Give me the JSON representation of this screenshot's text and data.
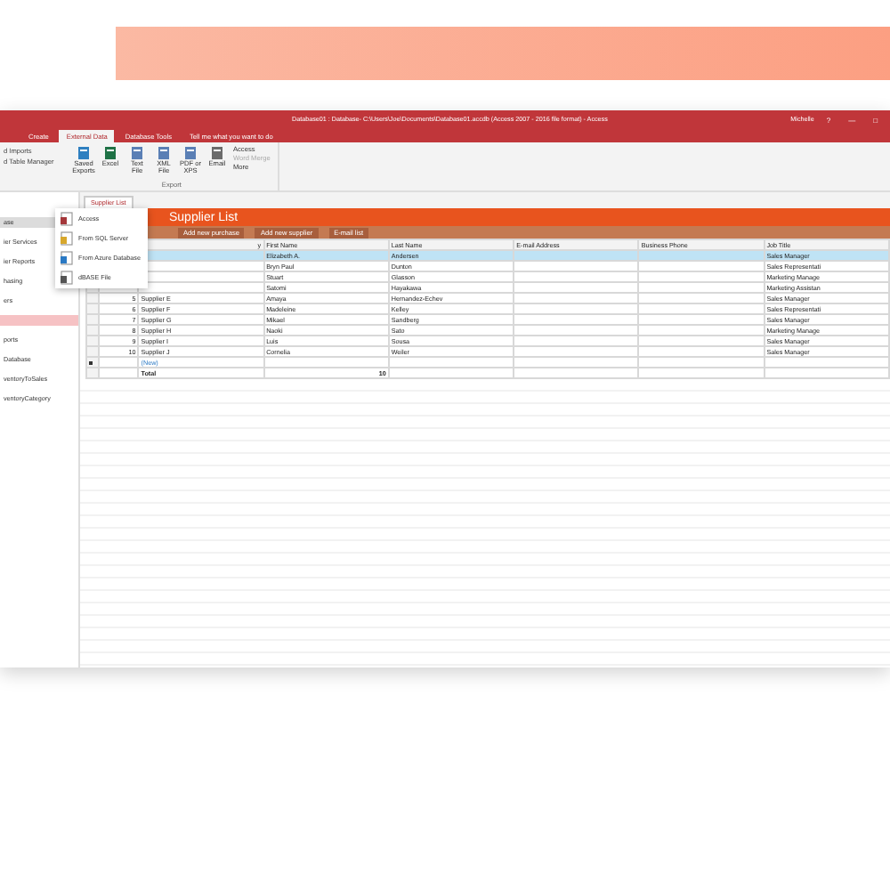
{
  "window": {
    "title": "Database01 : Database- C:\\Users\\Joe\\Documents\\Database01.accdb (Access 2007 - 2016 file format) - Access",
    "user": "Michelle",
    "controls": [
      "?",
      "—",
      "□"
    ]
  },
  "ribbon_tabs": [
    {
      "label": "Create",
      "selected": false
    },
    {
      "label": "External Data",
      "selected": true
    },
    {
      "label": "Database Tools",
      "selected": false
    }
  ],
  "tell_me": "Tell me what you want to do",
  "ribbon": {
    "left": [
      "d Imports",
      "d Table Manager"
    ],
    "buttons": [
      {
        "label": "Saved Exports",
        "kind": "saved"
      },
      {
        "label": "Excel",
        "kind": "excel"
      },
      {
        "label": "Text File",
        "kind": "text"
      },
      {
        "label": "XML File",
        "kind": "xml"
      },
      {
        "label": "PDF or XPS",
        "kind": "pdf"
      },
      {
        "label": "Email",
        "kind": "email"
      }
    ],
    "small": [
      {
        "label": "Access",
        "disabled": false
      },
      {
        "label": "Word Merge",
        "disabled": true
      },
      {
        "label": "More",
        "disabled": false
      }
    ],
    "group": "Export"
  },
  "nav": [
    {
      "label": "ase",
      "selected": true
    },
    {
      "label": "ier Services",
      "selected": false
    },
    {
      "label": "ier Reports",
      "selected": false
    },
    {
      "label": "hasing",
      "selected": false
    },
    {
      "label": "ers",
      "selected": false
    },
    {
      "label": "ports",
      "selected": false
    },
    {
      "label": "Database",
      "selected": false
    },
    {
      "label": "ventoryToSales",
      "selected": false
    },
    {
      "label": "ventoryCategory",
      "selected": false
    }
  ],
  "menu": [
    {
      "label": "Access",
      "kind": "access"
    },
    {
      "label": "From SQL Server",
      "kind": "sql"
    },
    {
      "label": "From Azure Database",
      "kind": "azure"
    },
    {
      "label": "dBASE File",
      "kind": "dbase"
    }
  ],
  "doc_tab": "Supplier List",
  "header": "Supplier List",
  "actions": [
    "Add new purchase",
    "Add new supplier",
    "E-mail list"
  ],
  "columns": [
    "y",
    "First Name",
    "Last Name",
    "E-mail Address",
    "Business Phone",
    "Job Title"
  ],
  "rows": [
    {
      "first": "Elizabeth A.",
      "last": "Andersen",
      "title": "Sales Manager",
      "selected": true
    },
    {
      "first": "Bryn Paul",
      "last": "Dunton",
      "title": "Sales Representati",
      "selected": false
    },
    {
      "first": "Stuart",
      "last": "Glasson",
      "title": "Marketing Manage",
      "selected": false
    },
    {
      "first": "Satomi",
      "last": "Hayakawa",
      "title": "Marketing Assistan",
      "selected": false
    },
    {
      "id": "5",
      "company": "Supplier E",
      "first": "Amaya",
      "last": "Hernandez-Echev",
      "title": "Sales Manager",
      "selected": false
    },
    {
      "id": "6",
      "company": "Supplier F",
      "first": "Madeleine",
      "last": "Kelley",
      "title": "Sales Representati",
      "selected": false
    },
    {
      "id": "7",
      "company": "Supplier G",
      "first": "Mikael",
      "last": "Sandberg",
      "title": "Sales Manager",
      "selected": false
    },
    {
      "id": "8",
      "company": "Supplier H",
      "first": "Naoki",
      "last": "Sato",
      "title": "Marketing Manage",
      "selected": false
    },
    {
      "id": "9",
      "company": "Supplier I",
      "first": "Luis",
      "last": "Sousa",
      "title": "Sales Manager",
      "selected": false
    },
    {
      "id": "10",
      "company": "Supplier J",
      "first": "Cornelia",
      "last": "Weiler",
      "title": "Sales Manager",
      "selected": false
    }
  ],
  "new_row": "(New)",
  "total_label": "Total",
  "total_value": "10"
}
